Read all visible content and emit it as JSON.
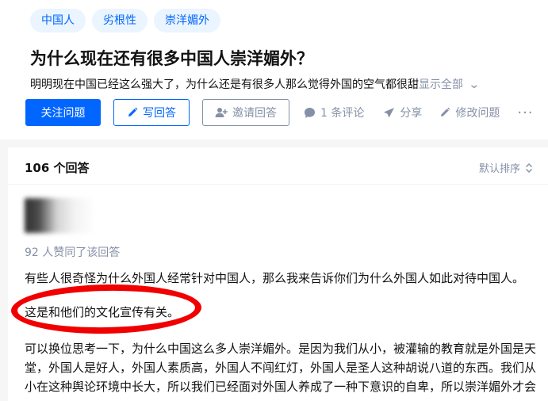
{
  "topics": [
    "中国人",
    "劣根性",
    "崇洋媚外"
  ],
  "question": {
    "title": "为什么现在还有很多中国人崇洋媚外？",
    "detail": "明明现在中国已经这么强大了，为什么还是有很多人那么觉得外国的空气都很甜",
    "show_all": "显示全部"
  },
  "actions": {
    "follow": "关注问题",
    "write": "写回答",
    "invite": "邀请回答",
    "comments": "1 条评论",
    "share": "分享",
    "edit": "修改问题",
    "more": "···"
  },
  "answers": {
    "count": "106 个回答",
    "sort": "默认排序"
  },
  "answer": {
    "upvotes": "92 人赞同了该回答",
    "p1": "有些人很奇怪为什么外国人经常针对中国人，那么我来告诉你们为什么外国人如此对待中国人。",
    "p2": "这是和他们的文化宣传有关。",
    "p3": "可以换位思考一下，为什么中国这么多人崇洋媚外。是因为我们从小，被灌输的教育就是外国是天堂，外国人是好人，外国人素质高，外国人不闯红灯，外国人是圣人这种胡说八道的东西。我们从小在这种舆论环境中长大，所以我们已经面对外国人养成了一种下意识的自卑，所以崇洋媚外才会"
  },
  "colors": {
    "brand_blue": "#0066ff",
    "topic_bg": "#ebf5ff",
    "muted": "#8590a6",
    "annotation_red": "#f00000"
  },
  "icons": [
    "pencil-icon",
    "add-user-icon",
    "comment-bubble-icon",
    "paper-plane-icon",
    "edit-pencil-icon",
    "more-dots-icon",
    "chevron-down-icon",
    "sort-updown-icon"
  ]
}
